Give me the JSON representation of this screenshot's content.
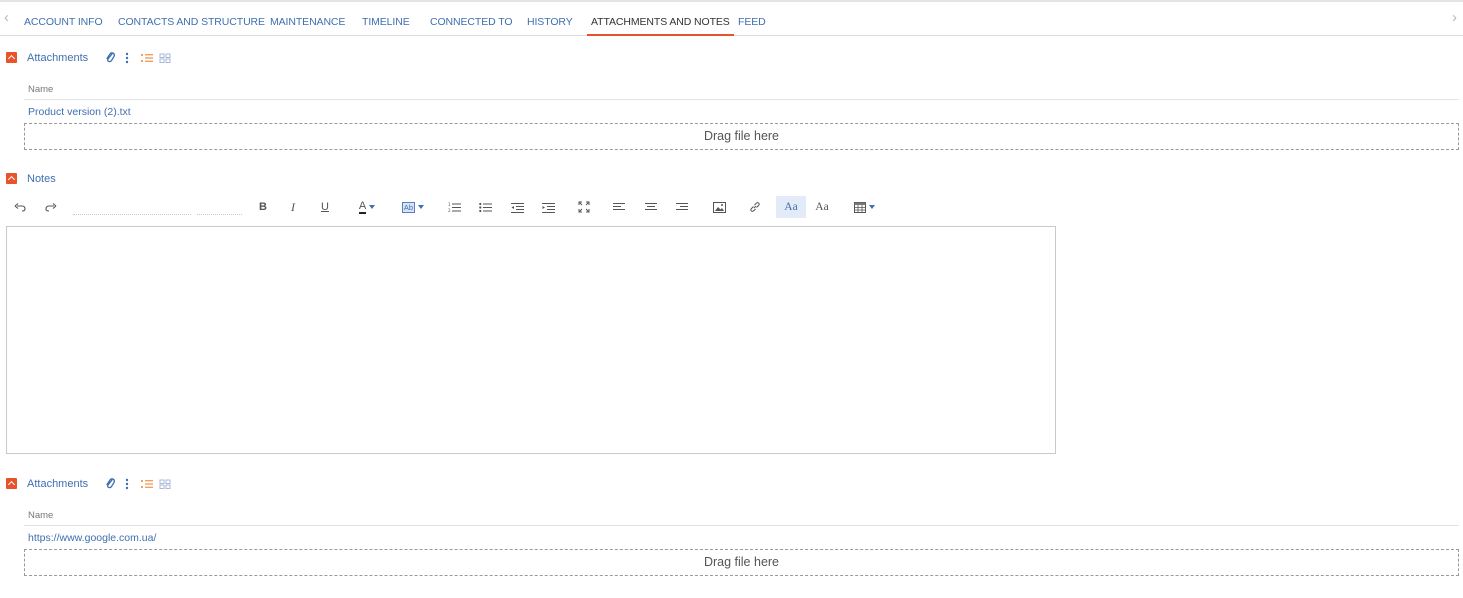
{
  "tabs": {
    "items": [
      {
        "label": "ACCOUNT INFO"
      },
      {
        "label": "CONTACTS AND STRUCTURE"
      },
      {
        "label": "MAINTENANCE"
      },
      {
        "label": "TIMELINE"
      },
      {
        "label": "CONNECTED TO"
      },
      {
        "label": "HISTORY"
      },
      {
        "label": "ATTACHMENTS AND NOTES"
      },
      {
        "label": "FEED"
      }
    ],
    "active_index": 6,
    "left_arrow": "‹",
    "right_arrow": "›"
  },
  "attachments_top": {
    "title": "Attachments",
    "column_name": "Name",
    "rows": [
      "Product version (2).txt"
    ],
    "dropzone": "Drag file here"
  },
  "notes": {
    "title": "Notes",
    "toolbar": {
      "bold": "B",
      "italic": "I",
      "underline": "U",
      "font_color": "A",
      "highlight": "Ab",
      "text_style_a": "Aa",
      "text_style_b": "Aa"
    },
    "content": ""
  },
  "attachments_bottom": {
    "title": "Attachments",
    "column_name": "Name",
    "rows": [
      "https://www.google.com.ua/"
    ],
    "dropzone": "Drag file here"
  },
  "colors": {
    "accent": "#e8532b",
    "link": "#3f6fb0"
  }
}
